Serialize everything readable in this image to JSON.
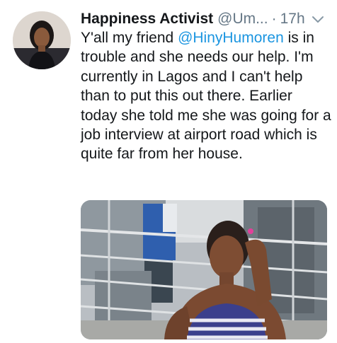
{
  "tweet": {
    "author": {
      "display_name": "Happiness Activist",
      "handle": "@Um...",
      "avatar_icon": "profile-photo"
    },
    "separator": "·",
    "time": "17h",
    "menu_icon": "chevron-down-icon",
    "text": {
      "before_mention": "Y'all my friend ",
      "mention": "@HinyHumoren",
      "after_mention": " is in trouble and she needs our help. I'm currently in Lagos and I can't help than to put this out there. Earlier today she told me she was going for a job interview at airport road which is quite far from her house."
    },
    "media": {
      "kind": "photo"
    }
  },
  "colors": {
    "text": "#14171a",
    "secondary": "#657786",
    "link": "#1b95e0"
  }
}
